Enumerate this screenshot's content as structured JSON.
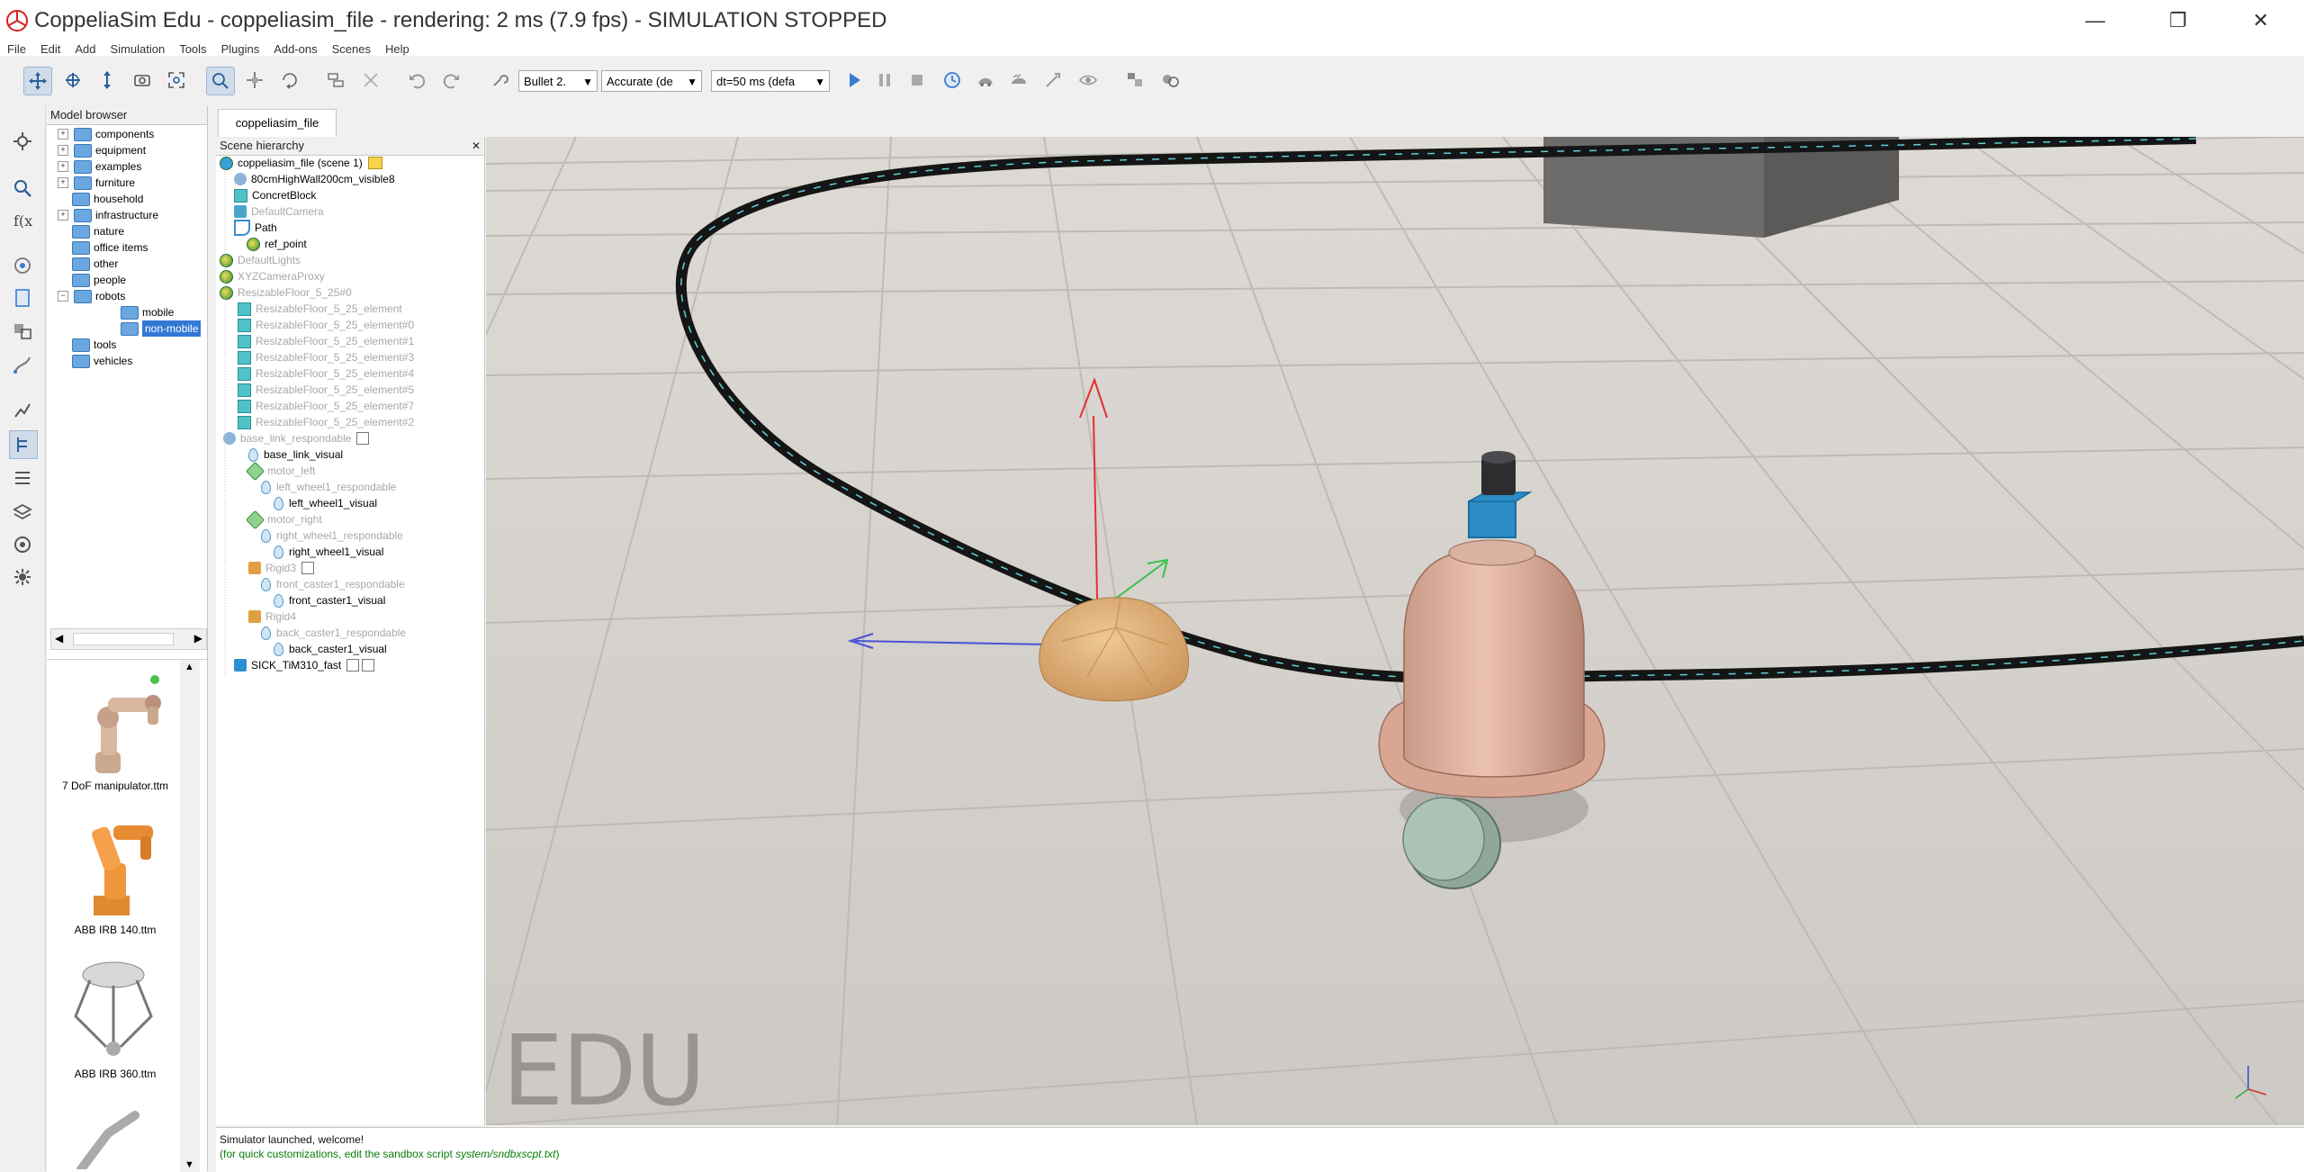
{
  "window": {
    "title": "CoppeliaSim Edu - coppeliasim_file - rendering: 2 ms (7.9 fps) - SIMULATION STOPPED",
    "minimize": "—",
    "maximize": "❐",
    "close": "✕"
  },
  "menu": [
    "File",
    "Edit",
    "Add",
    "Simulation",
    "Tools",
    "Plugins",
    "Add-ons",
    "Scenes",
    "Help"
  ],
  "toolbar": {
    "engine": "Bullet 2.",
    "accuracy": "Accurate (de",
    "timestep": "dt=50 ms (defa"
  },
  "model_browser": {
    "title": "Model browser",
    "folders": [
      {
        "label": "components",
        "expander": "+"
      },
      {
        "label": "equipment",
        "expander": "+"
      },
      {
        "label": "examples",
        "expander": "+"
      },
      {
        "label": "furniture",
        "expander": "+"
      },
      {
        "label": "household",
        "expander": ""
      },
      {
        "label": "infrastructure",
        "expander": "+"
      },
      {
        "label": "nature",
        "expander": ""
      },
      {
        "label": "office items",
        "expander": ""
      },
      {
        "label": "other",
        "expander": ""
      },
      {
        "label": "people",
        "expander": ""
      },
      {
        "label": "robots",
        "expander": "−"
      },
      {
        "label": "mobile",
        "expander": ""
      },
      {
        "label": "non-mobile",
        "expander": ""
      },
      {
        "label": "tools",
        "expander": ""
      },
      {
        "label": "vehicles",
        "expander": ""
      }
    ],
    "thumbnails": [
      {
        "label": "7 DoF manipulator.ttm"
      },
      {
        "label": "ABB IRB 140.ttm"
      },
      {
        "label": "ABB IRB 360.ttm"
      }
    ]
  },
  "scene_tab": "coppeliasim_file",
  "hierarchy": {
    "title": "Scene hierarchy",
    "close": "✕",
    "items": [
      {
        "label": "coppeliasim_file (scene 1)"
      },
      {
        "label": "80cmHighWall200cm_visible8"
      },
      {
        "label": "ConcretBlock"
      },
      {
        "label": "DefaultCamera"
      },
      {
        "label": "Path"
      },
      {
        "label": "ref_point"
      },
      {
        "label": "DefaultLights"
      },
      {
        "label": "XYZCameraProxy"
      },
      {
        "label": "ResizableFloor_5_25#0"
      },
      {
        "label": "ResizableFloor_5_25_element"
      },
      {
        "label": "ResizableFloor_5_25_element#0"
      },
      {
        "label": "ResizableFloor_5_25_element#1"
      },
      {
        "label": "ResizableFloor_5_25_element#3"
      },
      {
        "label": "ResizableFloor_5_25_element#4"
      },
      {
        "label": "ResizableFloor_5_25_element#5"
      },
      {
        "label": "ResizableFloor_5_25_element#7"
      },
      {
        "label": "ResizableFloor_5_25_element#2"
      },
      {
        "label": "base_link_respondable"
      },
      {
        "label": "base_link_visual"
      },
      {
        "label": "motor_left"
      },
      {
        "label": "left_wheel1_respondable"
      },
      {
        "label": "left_wheel1_visual"
      },
      {
        "label": "motor_right"
      },
      {
        "label": "right_wheel1_respondable"
      },
      {
        "label": "right_wheel1_visual"
      },
      {
        "label": "Rigid3"
      },
      {
        "label": "front_caster1_respondable"
      },
      {
        "label": "front_caster1_visual"
      },
      {
        "label": "Rigid4"
      },
      {
        "label": "back_caster1_respondable"
      },
      {
        "label": "back_caster1_visual"
      },
      {
        "label": "SICK_TiM310_fast"
      }
    ]
  },
  "viewport": {
    "watermark": "EDU"
  },
  "status": {
    "line1": "Simulator launched, welcome!",
    "line2_prefix": "(for quick customizations, edit the sandbox script ",
    "line2_path": "system/sndbxscpt.txt",
    "line2_suffix": ")"
  }
}
